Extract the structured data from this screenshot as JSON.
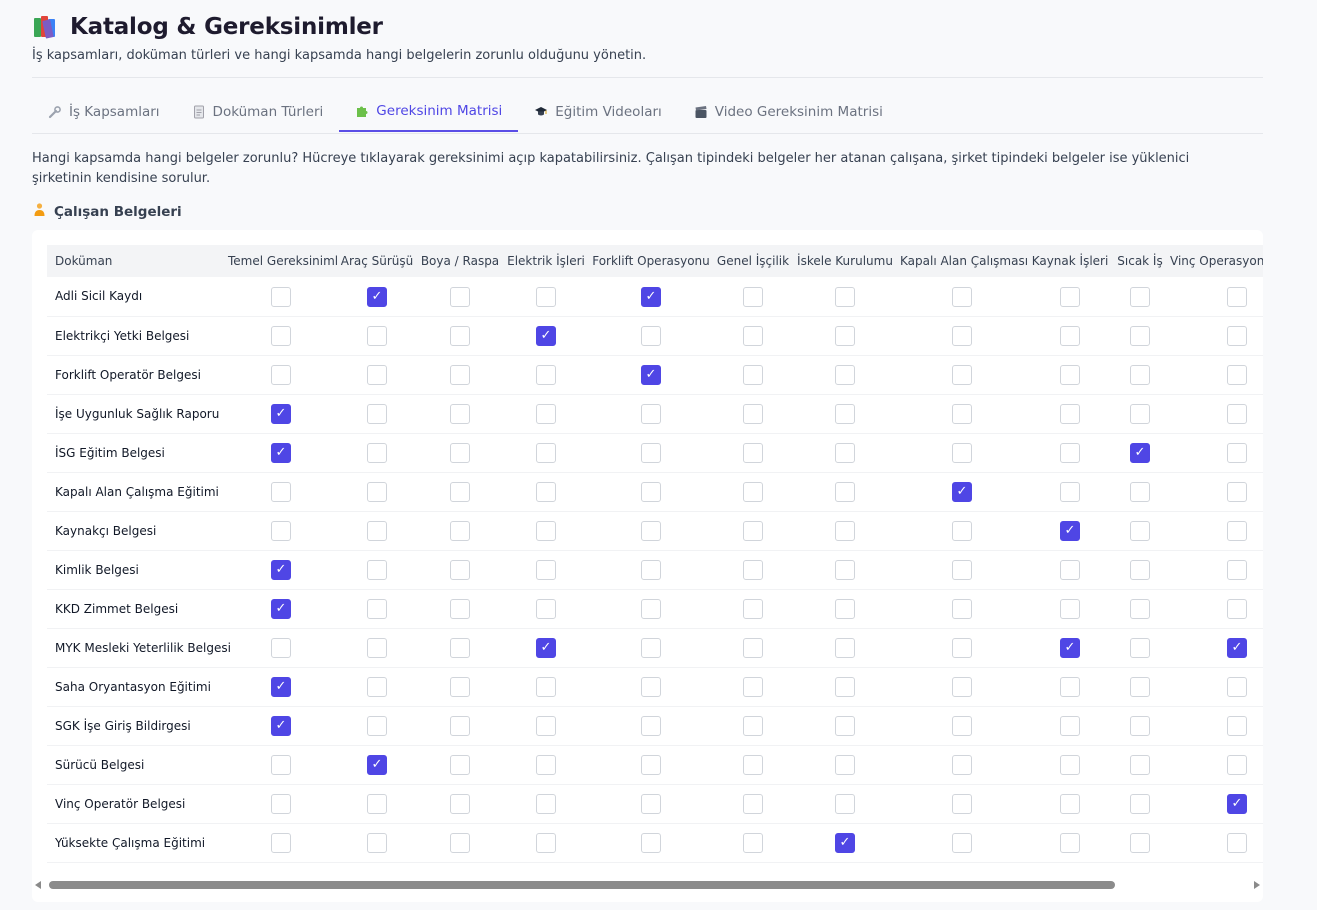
{
  "page": {
    "title": "Katalog & Gereksinimler",
    "subtitle": "İş kapsamları, doküman türleri ve hangi kapsamda hangi belgelerin zorunlu olduğunu yönetin.",
    "title_icon": "books-icon"
  },
  "tabs": [
    {
      "label": "İş Kapsamları",
      "icon": "wrench-icon",
      "active": false
    },
    {
      "label": "Doküman Türleri",
      "icon": "document-icon",
      "active": false
    },
    {
      "label": "Gereksinim Matrisi",
      "icon": "puzzle-icon",
      "active": true
    },
    {
      "label": "Eğitim Videoları",
      "icon": "graduation-cap-icon",
      "active": false
    },
    {
      "label": "Video Gereksinim Matrisi",
      "icon": "clapper-icon",
      "active": false
    }
  ],
  "description": "Hangi kapsamda hangi belgeler zorunlu? Hücreye tıklayarak gereksinimi açıp kapatabilirsiniz. Çalışan tipindeki belgeler her atanan çalışana, şirket tipindeki belgeler ise yüklenici şirketinin kendisine sorulur.",
  "section": {
    "title": "Çalışan Belgeleri",
    "icon": "worker-icon"
  },
  "matrix": {
    "doc_header": "Doküman",
    "columns": [
      "Temel Gereksinimler",
      "Araç Sürüşü",
      "Boya / Raspa",
      "Elektrik İşleri",
      "Forklift Operasyonu",
      "Genel İşçilik",
      "İskele Kurulumu",
      "Kapalı Alan Çalışması",
      "Kaynak İşleri",
      "Sıcak İş",
      "Vinç Operasyonu"
    ],
    "rows": [
      {
        "name": "Adli Sicil Kaydı",
        "checks": [
          0,
          1,
          0,
          0,
          1,
          0,
          0,
          0,
          0,
          0,
          0
        ]
      },
      {
        "name": "Elektrikçi Yetki Belgesi",
        "checks": [
          0,
          0,
          0,
          1,
          0,
          0,
          0,
          0,
          0,
          0,
          0
        ]
      },
      {
        "name": "Forklift Operatör Belgesi",
        "checks": [
          0,
          0,
          0,
          0,
          1,
          0,
          0,
          0,
          0,
          0,
          0
        ]
      },
      {
        "name": "İşe Uygunluk Sağlık Raporu",
        "checks": [
          1,
          0,
          0,
          0,
          0,
          0,
          0,
          0,
          0,
          0,
          0
        ]
      },
      {
        "name": "İSG Eğitim Belgesi",
        "checks": [
          1,
          0,
          0,
          0,
          0,
          0,
          0,
          0,
          0,
          1,
          0
        ]
      },
      {
        "name": "Kapalı Alan Çalışma Eğitimi",
        "checks": [
          0,
          0,
          0,
          0,
          0,
          0,
          0,
          1,
          0,
          0,
          0
        ]
      },
      {
        "name": "Kaynakçı Belgesi",
        "checks": [
          0,
          0,
          0,
          0,
          0,
          0,
          0,
          0,
          1,
          0,
          0
        ]
      },
      {
        "name": "Kimlik Belgesi",
        "checks": [
          1,
          0,
          0,
          0,
          0,
          0,
          0,
          0,
          0,
          0,
          0
        ]
      },
      {
        "name": "KKD Zimmet Belgesi",
        "checks": [
          1,
          0,
          0,
          0,
          0,
          0,
          0,
          0,
          0,
          0,
          0
        ]
      },
      {
        "name": "MYK Mesleki Yeterlilik Belgesi",
        "checks": [
          0,
          0,
          0,
          1,
          0,
          0,
          0,
          0,
          1,
          0,
          1
        ]
      },
      {
        "name": "Saha Oryantasyon Eğitimi",
        "checks": [
          1,
          0,
          0,
          0,
          0,
          0,
          0,
          0,
          0,
          0,
          0
        ]
      },
      {
        "name": "SGK İşe Giriş Bildirgesi",
        "checks": [
          1,
          0,
          0,
          0,
          0,
          0,
          0,
          0,
          0,
          0,
          0
        ]
      },
      {
        "name": "Sürücü Belgesi",
        "checks": [
          0,
          1,
          0,
          0,
          0,
          0,
          0,
          0,
          0,
          0,
          0
        ]
      },
      {
        "name": "Vinç Operatör Belgesi",
        "checks": [
          0,
          0,
          0,
          0,
          0,
          0,
          0,
          0,
          0,
          0,
          1
        ]
      },
      {
        "name": "Yüksekte Çalışma Eğitimi",
        "checks": [
          0,
          0,
          0,
          0,
          0,
          0,
          1,
          0,
          0,
          0,
          0
        ]
      }
    ]
  },
  "check_mark": "✓",
  "colors": {
    "accent": "#4f46e5",
    "background": "#f8f9fb",
    "card": "#ffffff"
  }
}
